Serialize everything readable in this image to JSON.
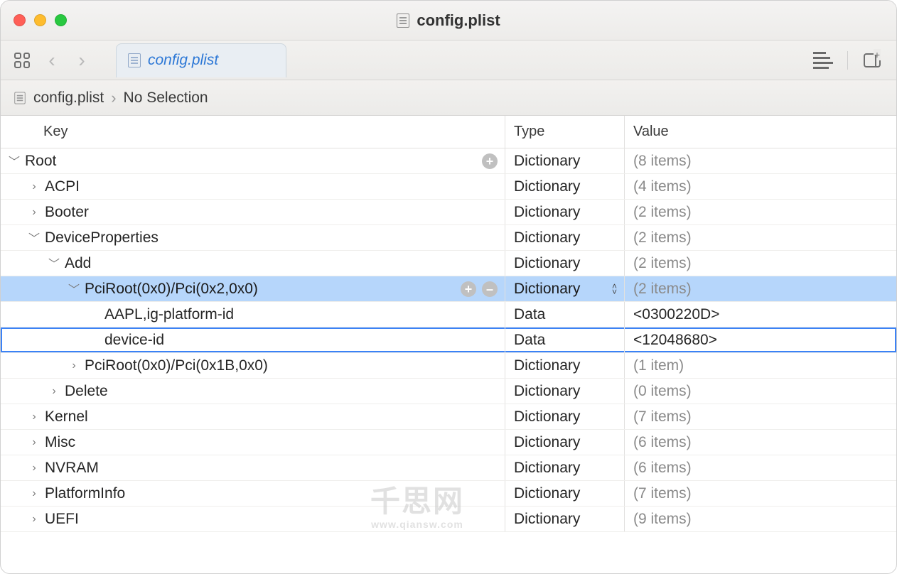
{
  "window": {
    "title": "config.plist"
  },
  "tab": {
    "title": "config.plist"
  },
  "path": {
    "file": "config.plist",
    "selection": "No Selection"
  },
  "columns": {
    "key": "Key",
    "type": "Type",
    "value": "Value"
  },
  "rows": [
    {
      "indent": 0,
      "disclosure": "open",
      "key": "Root",
      "type": "Dictionary",
      "value": "(8 items)",
      "actions": "plus",
      "selected": false
    },
    {
      "indent": 1,
      "disclosure": "closed",
      "key": "ACPI",
      "type": "Dictionary",
      "value": "(4 items)",
      "selected": false
    },
    {
      "indent": 1,
      "disclosure": "closed",
      "key": "Booter",
      "type": "Dictionary",
      "value": "(2 items)",
      "selected": false
    },
    {
      "indent": 1,
      "disclosure": "open",
      "key": "DeviceProperties",
      "type": "Dictionary",
      "value": "(2 items)",
      "selected": false
    },
    {
      "indent": 2,
      "disclosure": "open",
      "key": "Add",
      "type": "Dictionary",
      "value": "(2 items)",
      "selected": false
    },
    {
      "indent": 3,
      "disclosure": "open",
      "key": "PciRoot(0x0)/Pci(0x2,0x0)",
      "type": "Dictionary",
      "value": "(2 items)",
      "actions": "plusminus",
      "selected": true,
      "stepper": true
    },
    {
      "indent": 4,
      "disclosure": "none",
      "key": "AAPL,ig-platform-id",
      "type": "Data",
      "value": "<0300220D>",
      "valueKind": "data",
      "selected": false
    },
    {
      "indent": 4,
      "disclosure": "none",
      "key": "device-id",
      "type": "Data",
      "value": "<12048680>",
      "valueKind": "data",
      "selected": false,
      "outlined": true
    },
    {
      "indent": 3,
      "disclosure": "closed",
      "key": "PciRoot(0x0)/Pci(0x1B,0x0)",
      "type": "Dictionary",
      "value": "(1 item)",
      "selected": false
    },
    {
      "indent": 2,
      "disclosure": "closed",
      "key": "Delete",
      "type": "Dictionary",
      "value": "(0 items)",
      "selected": false
    },
    {
      "indent": 1,
      "disclosure": "closed",
      "key": "Kernel",
      "type": "Dictionary",
      "value": "(7 items)",
      "selected": false
    },
    {
      "indent": 1,
      "disclosure": "closed",
      "key": "Misc",
      "type": "Dictionary",
      "value": "(6 items)",
      "selected": false
    },
    {
      "indent": 1,
      "disclosure": "closed",
      "key": "NVRAM",
      "type": "Dictionary",
      "value": "(6 items)",
      "selected": false
    },
    {
      "indent": 1,
      "disclosure": "closed",
      "key": "PlatformInfo",
      "type": "Dictionary",
      "value": "(7 items)",
      "selected": false
    },
    {
      "indent": 1,
      "disclosure": "closed",
      "key": "UEFI",
      "type": "Dictionary",
      "value": "(9 items)",
      "selected": false
    }
  ],
  "watermark": {
    "main": "千思网",
    "sub": "www.qiansw.com"
  }
}
